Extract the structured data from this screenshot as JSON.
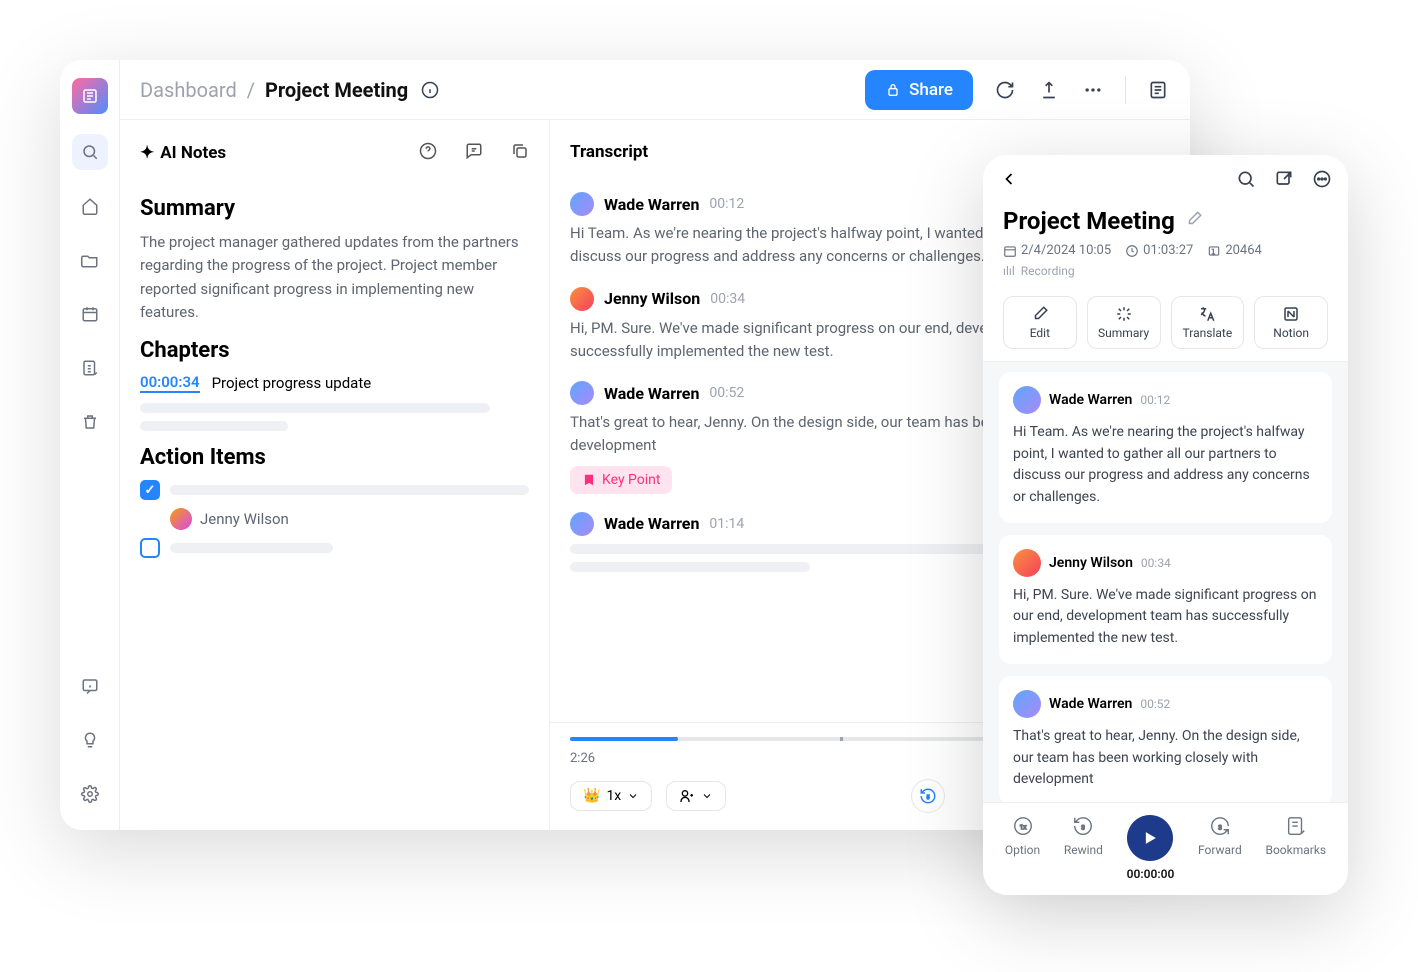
{
  "breadcrumb": {
    "dashboard": "Dashboard",
    "sep": "/",
    "current": "Project Meeting"
  },
  "topbar": {
    "share": "Share"
  },
  "notes": {
    "header": "AI Notes",
    "summary_h": "Summary",
    "summary_p": "The project manager gathered updates from the partners regarding the progress of the project. Project member reported significant progress in implementing new features.",
    "chapters_h": "Chapters",
    "chapter_time": "00:00:34",
    "chapter_title": "Project progress update",
    "action_h": "Action Items",
    "assignee": "Jenny Wilson"
  },
  "transcript": {
    "header": "Transcript",
    "entries": [
      {
        "name": "Wade Warren",
        "time": "00:12",
        "text": "Hi Team. As we're nearing the project's halfway point, I wanted to gather all our partners to discuss our progress and address any concerns or challenges."
      },
      {
        "name": "Jenny Wilson",
        "time": "00:34",
        "text": "Hi, PM. Sure. We've made significant progress on our end, development team has successfully implemented the new test."
      },
      {
        "name": "Wade Warren",
        "time": "00:52",
        "text": "That's great to hear, Jenny. On the design side, our team has been working closely with development",
        "keypoint": "Key Point"
      },
      {
        "name": "Wade Warren",
        "time": "01:14",
        "text": ""
      }
    ],
    "player": {
      "time": "2:26",
      "speed": "1x"
    }
  },
  "mobile": {
    "title": "Project Meeting",
    "date": "2/4/2024 10:05",
    "duration": "01:03:27",
    "words": "20464",
    "status": "Recording",
    "actions": {
      "edit": "Edit",
      "summary": "Summary",
      "translate": "Translate",
      "notion": "Notion"
    },
    "cards": [
      {
        "name": "Wade Warren",
        "time": "00:12",
        "text": "Hi Team. As we're nearing the project's halfway point, I wanted to gather all our partners to discuss our progress and address any concerns or challenges."
      },
      {
        "name": "Jenny Wilson",
        "time": "00:34",
        "text": "Hi, PM. Sure. We've made significant progress on our end, development team has successfully implemented the new test."
      },
      {
        "name": "Wade Warren",
        "time": "00:52",
        "text": "That's great to hear, Jenny. On the design side, our team has been working closely with development"
      }
    ],
    "player": {
      "option": "Option",
      "rewind": "Rewind",
      "time": "00:00:00",
      "forward": "Forward",
      "bookmarks": "Bookmarks"
    }
  }
}
